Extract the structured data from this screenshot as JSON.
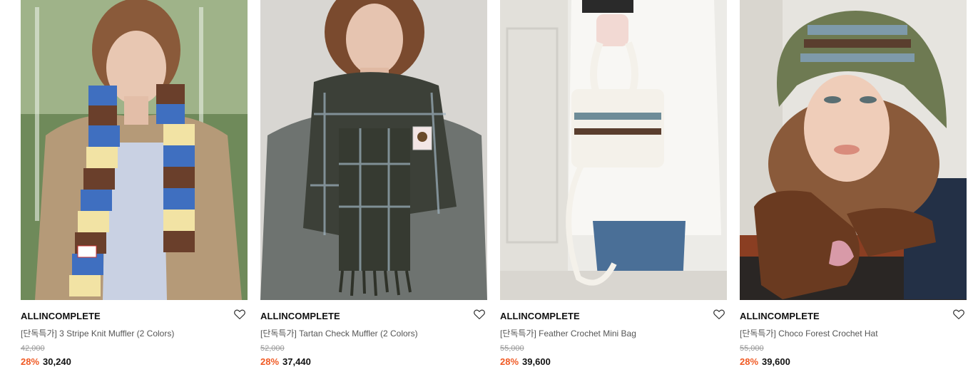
{
  "products": [
    {
      "brand": "ALLINCOMPLETE",
      "name": "[단독특가] 3 Stripe Knit Muffler (2 Colors)",
      "original_price": "42,000",
      "discount": "28%",
      "price": "30,240",
      "image_icon": "model-striped-muffler-image"
    },
    {
      "brand": "ALLINCOMPLETE",
      "name": "[단독특가] Tartan Check Muffler (2 Colors)",
      "original_price": "52,000",
      "discount": "28%",
      "price": "37,440",
      "image_icon": "model-tartan-muffler-image"
    },
    {
      "brand": "ALLINCOMPLETE",
      "name": "[단독특가] Feather Crochet Mini Bag",
      "original_price": "55,000",
      "discount": "28%",
      "price": "39,600",
      "image_icon": "crochet-mini-bag-image"
    },
    {
      "brand": "ALLINCOMPLETE",
      "name": "[단독특가] Choco Forest Crochet Hat",
      "original_price": "55,000",
      "discount": "28%",
      "price": "39,600",
      "image_icon": "model-crochet-hat-image"
    }
  ],
  "colors": {
    "discount": "#f05a24",
    "brand_text": "#111111",
    "name_text": "#555555",
    "original_price": "#999999"
  },
  "wishlist_icon": "heart-outline-icon"
}
